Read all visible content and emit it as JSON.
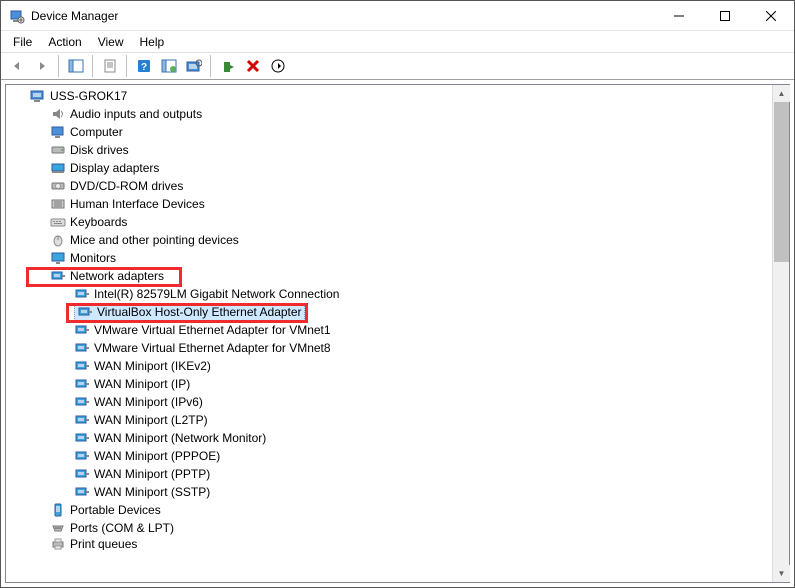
{
  "window": {
    "title": "Device Manager"
  },
  "menu": {
    "file": "File",
    "action": "Action",
    "view": "View",
    "help": "Help"
  },
  "tree": {
    "root": "USS-GROK17",
    "audio": "Audio inputs and outputs",
    "computer": "Computer",
    "disk": "Disk drives",
    "display": "Display adapters",
    "dvd": "DVD/CD-ROM drives",
    "hid": "Human Interface Devices",
    "keyboards": "Keyboards",
    "mice": "Mice and other pointing devices",
    "monitors": "Monitors",
    "network": "Network adapters",
    "net_items": {
      "intel": "Intel(R) 82579LM Gigabit Network Connection",
      "vbox": "VirtualBox Host-Only Ethernet Adapter",
      "vmnet1": "VMware Virtual Ethernet Adapter for VMnet1",
      "vmnet8": "VMware Virtual Ethernet Adapter for VMnet8",
      "wan_ikev2": "WAN Miniport (IKEv2)",
      "wan_ip": "WAN Miniport (IP)",
      "wan_ipv6": "WAN Miniport (IPv6)",
      "wan_l2tp": "WAN Miniport (L2TP)",
      "wan_netmon": "WAN Miniport (Network Monitor)",
      "wan_pppoe": "WAN Miniport (PPPOE)",
      "wan_pptp": "WAN Miniport (PPTP)",
      "wan_sstp": "WAN Miniport (SSTP)"
    },
    "portable": "Portable Devices",
    "ports": "Ports (COM & LPT)",
    "print": "Print queues"
  }
}
